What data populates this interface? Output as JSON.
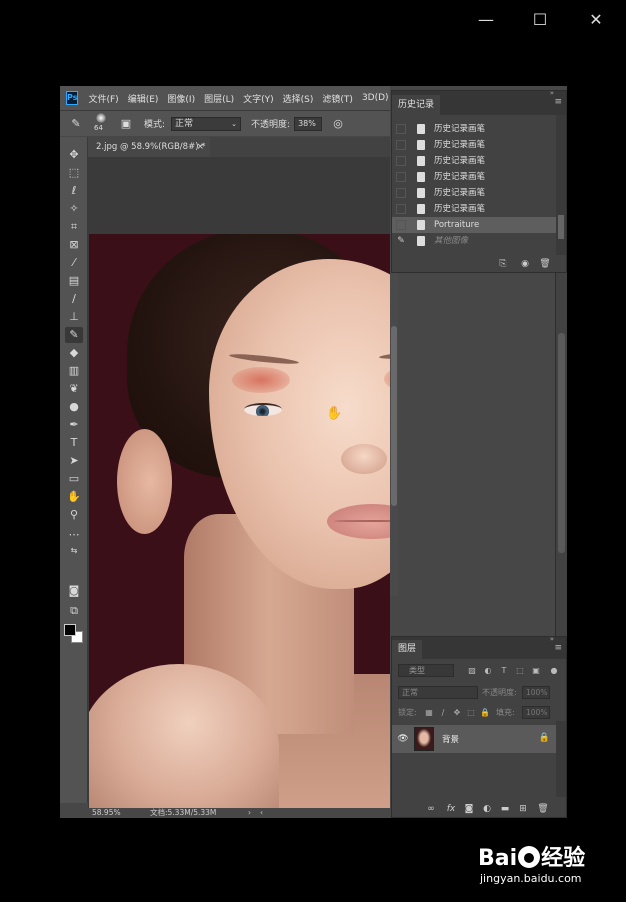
{
  "window_controls": {
    "minimize": "—",
    "maximize": "☐",
    "close": "✕"
  },
  "app": {
    "logo": "Ps"
  },
  "menu": [
    "文件(F)",
    "编辑(E)",
    "图像(I)",
    "图层(L)",
    "文字(Y)",
    "选择(S)",
    "滤镜(T)",
    "3D(D)"
  ],
  "options": {
    "brush_size": "64",
    "mode_label": "模式:",
    "mode_value": "正常",
    "opacity_label": "不透明度:",
    "opacity_value": "38%"
  },
  "document": {
    "tab_title": "2.jpg @ 58.9%(RGB/8#) *",
    "close_glyph": "×"
  },
  "status": {
    "zoom": "58.95%",
    "doc_size": "文档:5.33M/5.33M",
    "arrow_right": "›",
    "arrow_left": "‹"
  },
  "history": {
    "title": "历史记录",
    "items": [
      {
        "label": "历史记录画笔",
        "state": "normal"
      },
      {
        "label": "历史记录画笔",
        "state": "normal"
      },
      {
        "label": "历史记录画笔",
        "state": "normal"
      },
      {
        "label": "历史记录画笔",
        "state": "normal"
      },
      {
        "label": "历史记录画笔",
        "state": "normal"
      },
      {
        "label": "历史记录画笔",
        "state": "normal"
      },
      {
        "label": "Portraiture",
        "state": "selected"
      },
      {
        "label": "其他图像",
        "state": "future"
      }
    ]
  },
  "layers": {
    "title": "图层",
    "kind_placeholder": "类型",
    "blend_mode": "正常",
    "opacity_label": "不透明度:",
    "opacity_value": "100%",
    "lock_label": "锁定:",
    "fill_label": "填充:",
    "fill_value": "100%",
    "layer_name": "背景"
  },
  "watermark": {
    "logo_left": "Bai",
    "logo_right": "经验",
    "url": "jingyan.baidu.com"
  }
}
